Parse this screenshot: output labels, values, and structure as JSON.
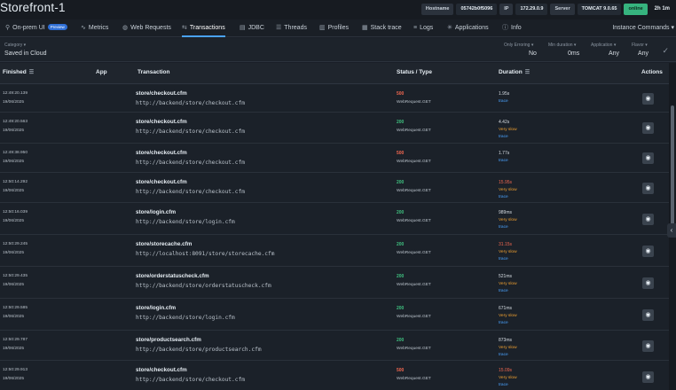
{
  "app": {
    "title": "Storefront-1",
    "hostname_label": "Hostname",
    "hostname_value": "05742b0f5096",
    "ip_label": "IP",
    "ip_value": "172.29.0.9",
    "server_label": "Server",
    "server_value": "TOMCAT 9.0.65",
    "status": "online",
    "uptime": "2h 1m"
  },
  "nav": {
    "items": [
      {
        "label": "On-prem UI",
        "icon": "pin-icon",
        "badge": "Preview"
      },
      {
        "label": "Metrics",
        "icon": "metrics-icon"
      },
      {
        "label": "Web Requests",
        "icon": "globe-icon"
      },
      {
        "label": "Transactions",
        "icon": "transactions-icon"
      },
      {
        "label": "JDBC",
        "icon": "jdbc-icon"
      },
      {
        "label": "Threads",
        "icon": "threads-icon"
      },
      {
        "label": "Profiles",
        "icon": "profiles-icon"
      },
      {
        "label": "Stack trace",
        "icon": "stack-icon"
      },
      {
        "label": "Logs",
        "icon": "logs-icon"
      },
      {
        "label": "Applications",
        "icon": "apps-icon"
      },
      {
        "label": "Info",
        "icon": "info-icon"
      }
    ],
    "active": "Transactions",
    "instance_commands": "Instance Commands"
  },
  "filters": {
    "category_label": "Category",
    "category_value": "Saved in Cloud",
    "erroring_label": "Only Erroring",
    "erroring_value": "No",
    "min_duration_label": "Min duration",
    "min_duration_value": "0ms",
    "application_label": "Application",
    "application_value": "Any",
    "flavor_label": "Flavor",
    "flavor_value": "Any"
  },
  "table": {
    "columns": [
      "Finished",
      "App",
      "Transaction",
      "Status / Type",
      "Duration",
      "Actions"
    ],
    "rows": [
      {
        "time": "12:49:20.139",
        "date": "19/06/2025",
        "name": "store/checkout.cfm",
        "url": "http://backend/store/checkout.cfm",
        "code": "500",
        "type": "WebRequest.GET",
        "duration": "1.95s",
        "speed": "",
        "trace": "trace"
      },
      {
        "time": "12:49:20.563",
        "date": "19/06/2025",
        "name": "store/checkout.cfm",
        "url": "http://backend/store/checkout.cfm",
        "code": "200",
        "type": "WebRequest.GET",
        "duration": "4.42s",
        "speed": "Very slow",
        "trace": "trace"
      },
      {
        "time": "12:49:38.950",
        "date": "19/06/2025",
        "name": "store/checkout.cfm",
        "url": "http://backend/store/checkout.cfm",
        "code": "500",
        "type": "WebRequest.GET",
        "duration": "1.77s",
        "speed": "",
        "trace": "trace"
      },
      {
        "time": "12:50:14.292",
        "date": "19/06/2025",
        "name": "store/checkout.cfm",
        "url": "http://backend/store/checkout.cfm",
        "code": "200",
        "type": "WebRequest.GET",
        "duration": "15.95s",
        "speed": "Very slow",
        "trace": "trace"
      },
      {
        "time": "12:50:16.039",
        "date": "19/06/2025",
        "name": "store/login.cfm",
        "url": "http://backend/store/login.cfm",
        "code": "200",
        "type": "WebRequest.GET",
        "duration": "989ms",
        "speed": "Very slow",
        "trace": "trace"
      },
      {
        "time": "12:50:29.245",
        "date": "19/06/2025",
        "name": "store/storecache.cfm",
        "url": "http://localhost:8091/store/storecache.cfm",
        "code": "200",
        "type": "WebRequest.GET",
        "duration": "31.15s",
        "speed": "Very slow",
        "trace": "trace"
      },
      {
        "time": "12:50:29.435",
        "date": "19/06/2025",
        "name": "store/orderstatuscheck.cfm",
        "url": "http://backend/store/orderstatuscheck.cfm",
        "code": "200",
        "type": "WebRequest.GET",
        "duration": "521ms",
        "speed": "Very slow",
        "trace": "trace"
      },
      {
        "time": "12:50:29.585",
        "date": "19/06/2025",
        "name": "store/login.cfm",
        "url": "http://backend/store/login.cfm",
        "code": "200",
        "type": "WebRequest.GET",
        "duration": "671ms",
        "speed": "Very slow",
        "trace": "trace"
      },
      {
        "time": "12:50:29.787",
        "date": "19/06/2025",
        "name": "store/productsearch.cfm",
        "url": "http://backend/store/productsearch.cfm",
        "code": "200",
        "type": "WebRequest.GET",
        "duration": "873ms",
        "speed": "Very slow",
        "trace": "trace"
      },
      {
        "time": "12:50:29.913",
        "date": "19/06/2025",
        "name": "store/checkout.cfm",
        "url": "http://backend/store/checkout.cfm",
        "code": "500",
        "type": "WebRequest.GET",
        "duration": "15.09s",
        "speed": "Very slow",
        "trace": "trace"
      }
    ]
  },
  "colors": {
    "accent": "#4aa3ff",
    "error_code": "#f0674f",
    "ok_code": "#3fbf7f",
    "slow": "#f0a030",
    "slow_duration": "#f0674f"
  }
}
